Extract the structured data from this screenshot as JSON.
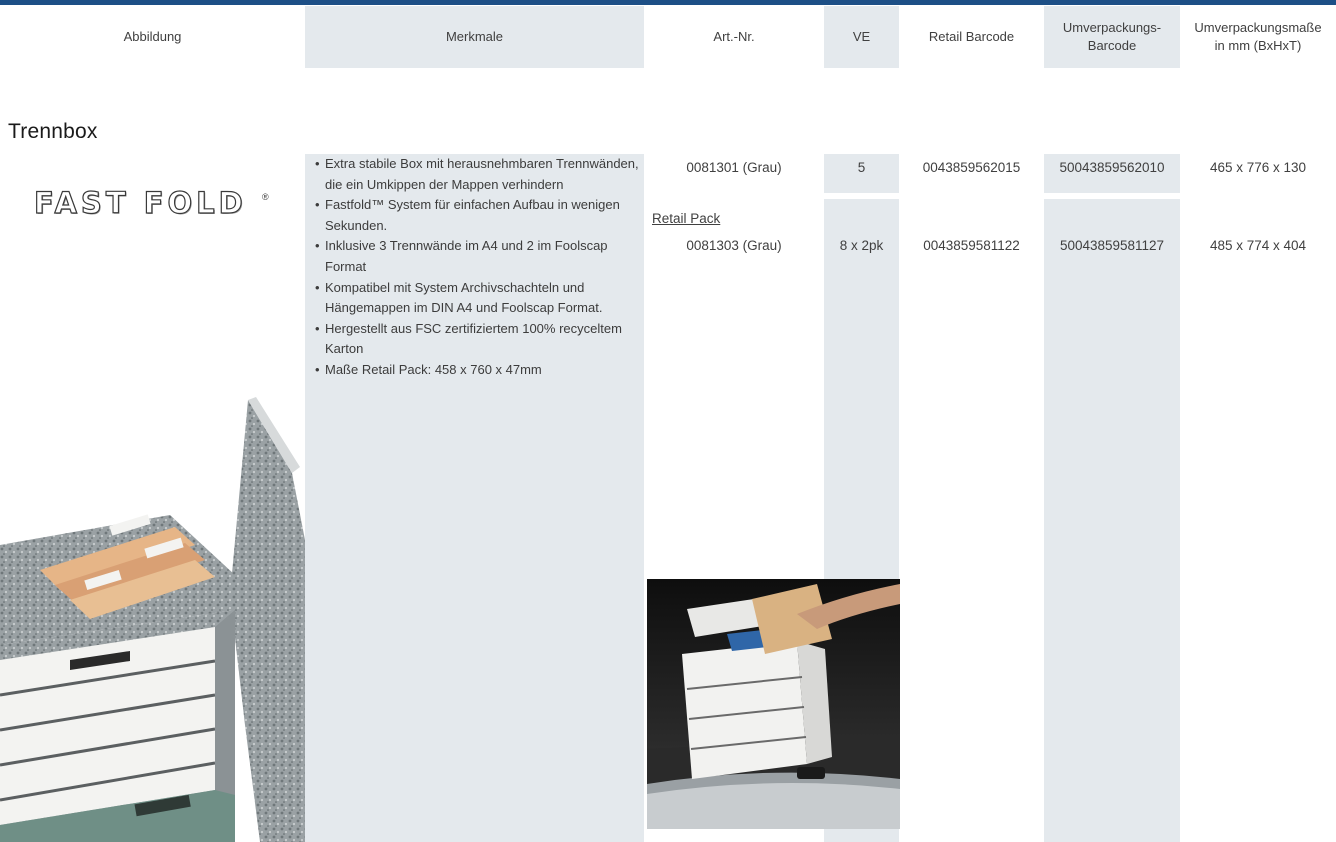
{
  "header": {
    "abbildung": "Abbildung",
    "merkmale": "Merkmale",
    "art_nr": "Art.-Nr.",
    "ve": "VE",
    "retail_barcode": "Retail Barcode",
    "umverpackungs_barcode": "Umverpackungs-\nBarcode",
    "umverpackungs_masse": "Umverpackungsmaße\nin mm (BxHxT)"
  },
  "section": {
    "title": "Trennbox"
  },
  "logo": {
    "text": "FAST FOLD"
  },
  "features": [
    "Extra stabile Box mit herausnehmbaren Trennwänden, die ein Umkippen der Mappen verhindern",
    "Fastfold™ System für einfachen Aufbau in wenigen Sekunden.",
    "Inklusive 3 Trennwände im A4 und 2 im Foolscap Format",
    "Kompatibel mit System Archivschachteln und Hängemappen im DIN A4 und Foolscap Format.",
    "Hergestellt aus FSC zertifiziertem 100% recyceltem Karton",
    "Maße Retail Pack: 458 x 760 x 47mm"
  ],
  "rows": [
    {
      "art_nr": "0081301 (Grau)",
      "ve": "5",
      "retail_barcode": "0043859562015",
      "umverpackungs_barcode": "50043859562010",
      "masse": "465 x 776 x 130"
    },
    {
      "label": "Retail Pack",
      "art_nr": "0081303 (Grau)",
      "ve": "8 x 2pk",
      "retail_barcode": "0043859581122",
      "umverpackungs_barcode": "50043859581127",
      "masse": "485 x 774 x 404"
    }
  ],
  "colors": {
    "top_bar": "#1d4f86",
    "column_shade": "#e4e9ed",
    "box_grey": "#8c9396",
    "box_white": "#f3f3f1",
    "box_green_band": "#6f8f86"
  }
}
